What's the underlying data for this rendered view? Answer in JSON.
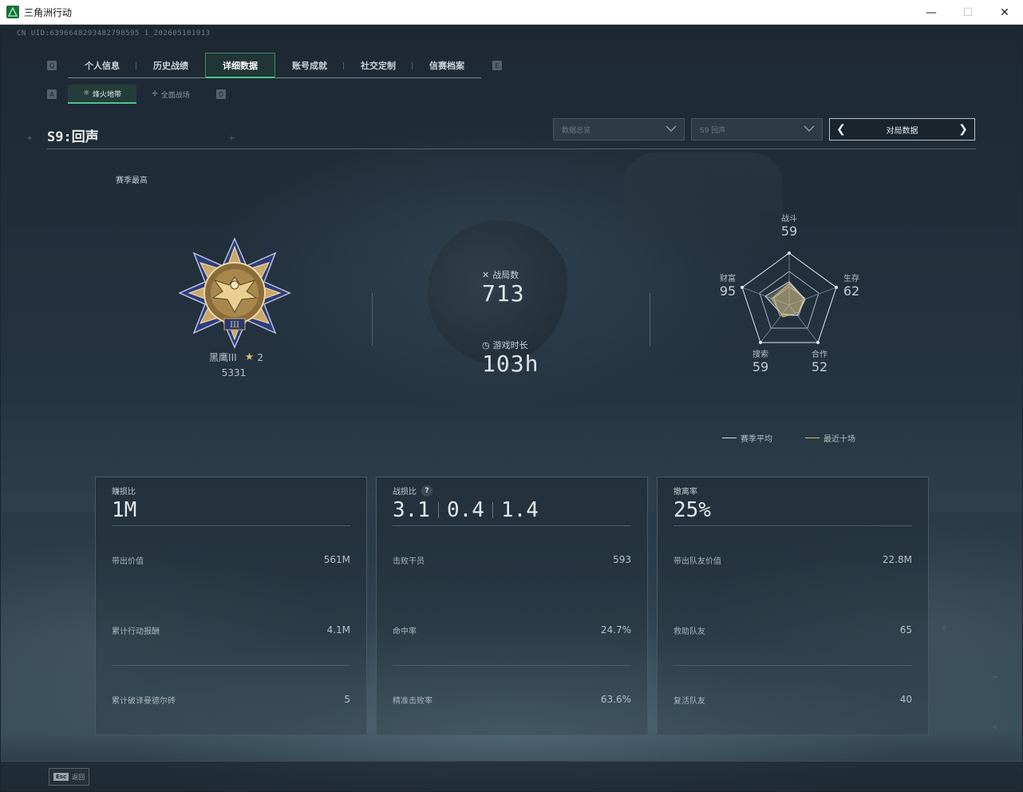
{
  "window": {
    "title": "三角洲行动",
    "minimize": "—",
    "maximize": "☐",
    "close": "✕"
  },
  "uid": "CN UID:6396648293482798595 1_202605101913",
  "tabs": {
    "left_key": "Q",
    "right_key": "E",
    "items": [
      {
        "label": "个人信息"
      },
      {
        "label": "历史战绩"
      },
      {
        "label": "详细数据",
        "active": true
      },
      {
        "label": "账号成就"
      },
      {
        "label": "社交定制"
      },
      {
        "label": "信赛档案"
      }
    ]
  },
  "subtabs": {
    "left_key": "A",
    "right_key": "D",
    "items": [
      {
        "label": "烽火地带",
        "active": true,
        "icon": "hazard-icon"
      },
      {
        "label": "全面战场",
        "active": false,
        "icon": "battlefield-icon"
      }
    ]
  },
  "season": {
    "title": "S9:回声",
    "best_label": "赛季最高"
  },
  "filters": {
    "data_type": "数据总览",
    "season": "S9 回声",
    "mode_label": "对局数据",
    "prev_arrow": "❮",
    "next_arrow": "❯"
  },
  "rank": {
    "name": "黑鹰III",
    "stars": "2",
    "points": "5331",
    "medal_numeral": "III",
    "accent": "#d8b872"
  },
  "overview": {
    "matches_label": "战局数",
    "matches_value": "713",
    "playtime_label": "游戏时长",
    "playtime_value": "103h"
  },
  "radar": {
    "axes": [
      {
        "label": "战斗",
        "value": "59"
      },
      {
        "label": "生存",
        "value": "62"
      },
      {
        "label": "合作",
        "value": "52"
      },
      {
        "label": "搜索",
        "value": "59"
      },
      {
        "label": "财富",
        "value": "95"
      }
    ],
    "legend": {
      "season_avg": "赛季平均",
      "recent_ten": "最近十场",
      "season_avg_color": "#d6dde1",
      "recent_ten_color": "#d8b872"
    }
  },
  "cards": {
    "profit": {
      "title": "赚损比",
      "main": "1M",
      "rows": [
        {
          "label": "带出价值",
          "value": "561M"
        },
        {
          "label": "累计行动报酬",
          "value": "4.1M"
        },
        {
          "label": "累计破译曼德尔砖",
          "value": "5"
        }
      ]
    },
    "kd": {
      "title": "战损比",
      "help": "?",
      "main": [
        "3.1",
        "0.4",
        "1.4"
      ],
      "rows": [
        {
          "label": "击败干员",
          "value": "593"
        },
        {
          "label": "命中率",
          "value": "24.7%"
        },
        {
          "label": "精准击败率",
          "value": "63.6%"
        }
      ]
    },
    "extract": {
      "title": "撤离率",
      "main": "25%",
      "rows": [
        {
          "label": "带出队友价值",
          "value": "22.8M"
        },
        {
          "label": "救助队友",
          "value": "65"
        },
        {
          "label": "复活队友",
          "value": "40"
        }
      ]
    }
  },
  "bottom": {
    "esc_key": "Esc",
    "esc_label": "返回"
  }
}
